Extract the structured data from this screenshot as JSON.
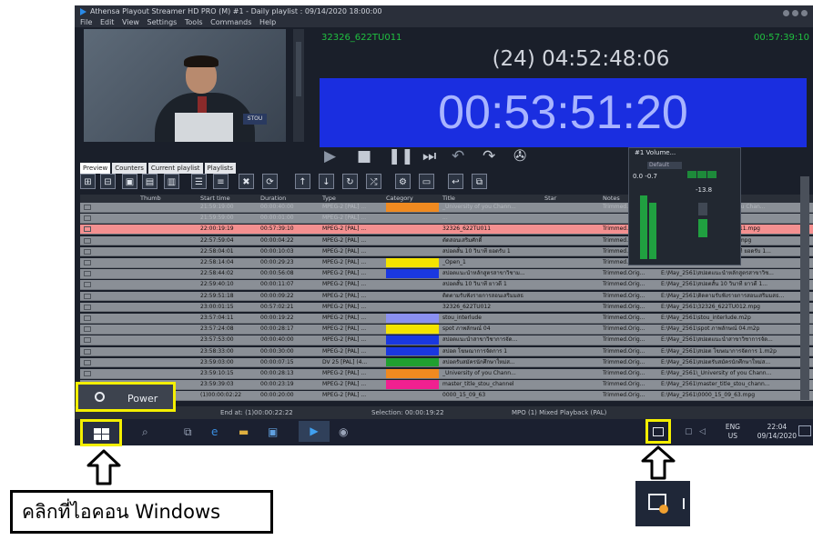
{
  "window": {
    "title": "Athensa Playout Streamer HD PRO (M) #1 - Daily playlist : 09/14/2020 18:00:00",
    "menu": [
      "File",
      "Edit",
      "View",
      "Settings",
      "Tools",
      "Commands",
      "Help"
    ]
  },
  "player": {
    "clip_name": "32326_622TU011",
    "elapsed": "00:57:39:10",
    "remaining": "(24) 04:52:48:06",
    "countdown": "00:53:51:20"
  },
  "tabs": [
    "Preview",
    "Counters",
    "Current playlist",
    "Playlists"
  ],
  "playlist": {
    "columns": [
      "Thumb",
      "Start time",
      "Duration",
      "Type",
      "Category",
      "Title",
      "Star",
      "Notes"
    ],
    "rows": [
      {
        "start": "21:59:19:00",
        "duration": "00:00:40:00",
        "type": "MPEG-2 [PAL] ...",
        "color": "#f08a20",
        "title": "_University of you Chann...",
        "notes": "Trimmed.Orig...",
        "file": "E:\\May_2561\\University of you Chan..."
      },
      {
        "start": "21:59:59:00",
        "duration": "00:00:01:00",
        "type": "MPEG-2 [PAL] ...",
        "color": "",
        "title": "...",
        "notes": "",
        "file": ""
      },
      {
        "start": "22:00:19:19",
        "duration": "00:57:39:10",
        "type": "MPEG-2 [PAL] ...",
        "color": "",
        "title": "32326_622TU011",
        "notes": "Trimmed.Orig...",
        "file": "E:\\May_2561\\32326_622TU011.mpg"
      },
      {
        "start": "22:57:59:04",
        "duration": "00:00:04:22",
        "type": "MPEG-2 [PAL] ...",
        "color": "",
        "title": "ตัดสอนเสริมศักดิ์",
        "notes": "Trimmed.Orig...",
        "file": "E:\\May_2561\\ตัดสอนเสริมศักดิ์.mpg"
      },
      {
        "start": "22:58:04:01",
        "duration": "00:00:10:03",
        "type": "MPEG-2 [PAL] ...",
        "color": "",
        "title": "สปอตสั้น 10 วินาที ยอดรับ 1",
        "notes": "Trimmed.Orig...",
        "file": "E:\\May_2561\\สปอตสั้น 10 วินาที ยอดรับ 1..."
      },
      {
        "start": "22:58:14:04",
        "duration": "00:00:29:23",
        "type": "MPEG-2 [PAL] ...",
        "color": "#f4e400",
        "title": "_Open_1",
        "notes": "Trimmed.Orig...",
        "file": "E:\\May_2561\\_Open_1.m2p"
      },
      {
        "start": "22:58:44:02",
        "duration": "00:00:56:08",
        "type": "MPEG-2 [PAL] ...",
        "color": "#1a38e0",
        "title": "สปอตแนะนำหลักสูตรสาขาวิชาม...",
        "notes": "Trimmed.Orig...",
        "file": "E:\\May_2561\\สปอตแนะนำหลักสูตรสาขาวิช..."
      },
      {
        "start": "22:59:40:10",
        "duration": "00:00:11:07",
        "type": "MPEG-2 [PAL] ...",
        "color": "",
        "title": "สปอตสั้น 10 วินาที ยาวดี 1",
        "notes": "Trimmed.Orig...",
        "file": "E:\\May_2561\\สปอตสั้น 10 วินาที ยาวดี 1..."
      },
      {
        "start": "22:59:51:18",
        "duration": "00:00:09:22",
        "type": "MPEG-2 [PAL] ...",
        "color": "",
        "title": "ติดตามรับฟังรายการสอนเสริมมสธ",
        "notes": "Trimmed.Orig...",
        "file": "E:\\May_2561\\ติดตามรับฟังรายการสอนเสริมมสธ..."
      },
      {
        "start": "23:00:01:15",
        "duration": "00:57:02:21",
        "type": "MPEG-2 [PAL] ...",
        "color": "",
        "title": "32326_622TU012",
        "notes": "Trimmed.Orig...",
        "file": "E:\\May_2561\\32326_622TU012.mpg"
      },
      {
        "start": "23:57:04:11",
        "duration": "00:00:19:22",
        "type": "MPEG-2 [PAL] ...",
        "color": "#8a90f0",
        "title": "stou_interlude",
        "notes": "Trimmed.Orig...",
        "file": "E:\\May_2561\\stou_interlude.m2p"
      },
      {
        "start": "23:57:24:08",
        "duration": "00:00:28:17",
        "type": "MPEG-2 [PAL] ...",
        "color": "#f4e400",
        "title": "spot ภาพลักษณ์ 04",
        "notes": "Trimmed.Orig...",
        "file": "E:\\May_2561\\spot ภาพลักษณ์ 04.m2p"
      },
      {
        "start": "23:57:53:00",
        "duration": "00:00:40:00",
        "type": "MPEG-2 [PAL] ...",
        "color": "#1a38e0",
        "title": "สปอตแนะนำสาขาวิชาการจัด...",
        "notes": "Trimmed.Orig...",
        "file": "E:\\May_2561\\สปอตแนะนำสาขาวิชาการจัด..."
      },
      {
        "start": "23:58:33:00",
        "duration": "00:00:30:00",
        "type": "MPEG-2 [PAL] ...",
        "color": "#1a38e0",
        "title": "สปอต โฆษณาการจัดการ 1",
        "notes": "Trimmed.Orig...",
        "file": "E:\\May_2561\\สปอต โฆษณาการจัดการ 1.m2p"
      },
      {
        "start": "23:59:03:00",
        "duration": "00:00:07:15",
        "type": "DV 25 [PAL] (4...",
        "color": "#20a030",
        "title": "สปอตรับสมัครนักศึกษาใหม่ส...",
        "notes": "Trimmed.Orig...",
        "file": "E:\\May_2561\\สปอตรับสมัครนักศึกษาใหม่ส..."
      },
      {
        "start": "23:59:10:15",
        "duration": "00:00:28:13",
        "type": "MPEG-2 [PAL] ...",
        "color": "#f08a20",
        "title": "_University of you Chann...",
        "notes": "Trimmed.Orig...",
        "file": "E:\\May_2561\\_University of you Chann..."
      },
      {
        "start": "23:59:39:03",
        "duration": "00:00:23:19",
        "type": "MPEG-2 [PAL] ...",
        "color": "#f02090",
        "title": "master_title_stou_channel",
        "notes": "Trimmed.Orig...",
        "file": "E:\\May_2561\\master_title_stou_chann..."
      },
      {
        "start": "(1)00:00:02:22",
        "duration": "00:00:20:00",
        "type": "MPEG-2 [PAL] ...",
        "color": "",
        "title": "0000_15_09_63",
        "notes": "Trimmed.Orig...",
        "file": "E:\\May_2561\\0000_15_09_63.mpg"
      }
    ]
  },
  "status": {
    "end_at": "End at: (1)00:00:22:22",
    "selection": "Selection: 00:00:19:22",
    "mode": "MPO (1) Mixed Playback (PAL)"
  },
  "volume": {
    "title": "#1 Volume...",
    "mode": "Default",
    "values": "0.0 -0.7",
    "level": "-13.8"
  },
  "start_menu": {
    "power_label": "Power"
  },
  "taskbar": {
    "lang": "ENG",
    "region": "US",
    "time": "22:04",
    "date": "09/14/2020"
  },
  "callout": {
    "text": "คลิกที่ไอคอน Windows"
  },
  "colors": {
    "highlight": "#f4ef00",
    "countdown_bg": "#1a2ee0",
    "playing_row": "#f49090",
    "clock_green": "#20c040"
  }
}
